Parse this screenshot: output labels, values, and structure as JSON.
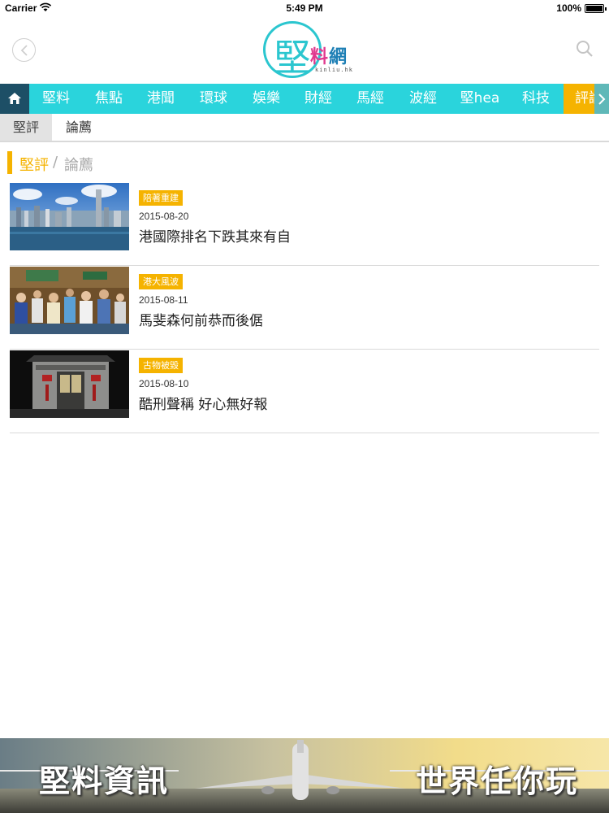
{
  "status_bar": {
    "carrier": "Carrier",
    "time": "5:49 PM",
    "battery": "100%"
  },
  "header": {
    "logo_big": "堅",
    "logo_small_1": "料",
    "logo_small_2": "網",
    "logo_url": "kinliu.hk"
  },
  "nav": {
    "items": [
      {
        "label": "堅料"
      },
      {
        "label": "焦點"
      },
      {
        "label": "港聞"
      },
      {
        "label": "環球"
      },
      {
        "label": "娛樂"
      },
      {
        "label": "財經"
      },
      {
        "label": "馬經"
      },
      {
        "label": "波經"
      },
      {
        "label": "堅hea"
      },
      {
        "label": "科技"
      },
      {
        "label": "評論"
      }
    ],
    "active_index": 10
  },
  "subtabs": [
    {
      "label": "堅評"
    },
    {
      "label": "論薦"
    }
  ],
  "section": {
    "primary": "堅評",
    "separator": "/",
    "secondary": "論薦"
  },
  "articles": [
    {
      "tag": "陪著重建",
      "date": "2015-08-20",
      "title": "港國際排名下跌其來有自"
    },
    {
      "tag": "港大風波",
      "date": "2015-08-11",
      "title": "馬斐森何前恭而後倨"
    },
    {
      "tag": "古物被毀",
      "date": "2015-08-10",
      "title": "酷刑聲稱 好心無好報"
    }
  ],
  "banner": {
    "left_text": "堅料資訊",
    "right_text": "世界任你玩"
  },
  "colors": {
    "accent_cyan": "#2ad4dc",
    "accent_yellow": "#f5b300",
    "home_bg": "#1d4f66"
  }
}
